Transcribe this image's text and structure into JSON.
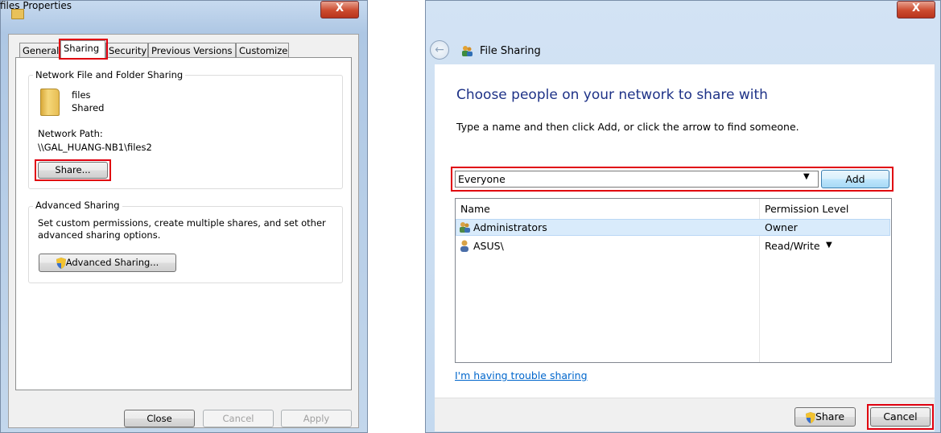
{
  "left_dialog": {
    "title": "files Properties",
    "close_glyph": "X",
    "tabs": [
      "General",
      "Sharing",
      "Security",
      "Previous Versions",
      "Customize"
    ],
    "network_group": {
      "label": "Network File and Folder Sharing",
      "folder_name": "files",
      "folder_status": "Shared",
      "path_label": "Network Path:",
      "path_value": "\\\\GAL_HUANG-NB1\\files2",
      "share_button": "Share..."
    },
    "advanced_group": {
      "label": "Advanced Sharing",
      "description_line1": "Set custom permissions, create multiple shares, and set other",
      "description_line2": "advanced sharing options.",
      "button": "Advanced Sharing..."
    },
    "footer": {
      "close": "Close",
      "cancel": "Cancel",
      "apply": "Apply"
    }
  },
  "right_dialog": {
    "title": "File Sharing",
    "close_glyph": "X",
    "heading": "Choose people on your network to share with",
    "instruction": "Type a name and then click Add, or click the arrow to find someone.",
    "name_input_value": "Everyone",
    "add_button": "Add",
    "columns": {
      "name": "Name",
      "permission": "Permission Level"
    },
    "rows": [
      {
        "name": "Administrators",
        "permission": "Owner"
      },
      {
        "name": "ASUS\\",
        "permission": "Read/Write"
      }
    ],
    "trouble_link": "I'm having trouble sharing",
    "footer": {
      "share": "Share",
      "cancel": "Cancel"
    }
  },
  "colors": {
    "highlight_red": "#e0000f",
    "heading_blue": "#1e3287",
    "link_blue": "#0066cc"
  },
  "icons": [
    "folder-icon",
    "close-icon",
    "shield-icon",
    "back-arrow-icon",
    "file-sharing-icon",
    "group-users-icon",
    "user-icon",
    "dropdown-arrow-icon"
  ]
}
